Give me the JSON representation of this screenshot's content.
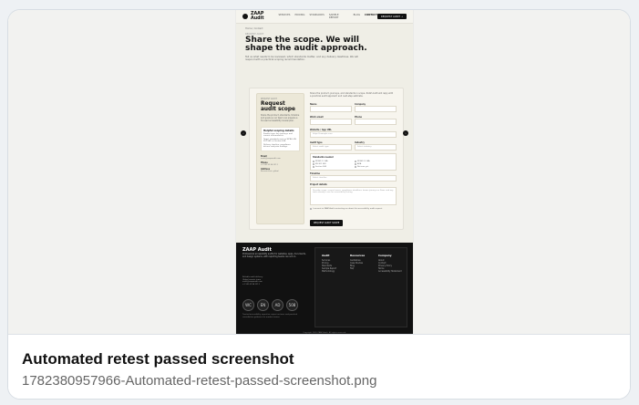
{
  "browser_capture": {
    "nav": {
      "brand": "ZAAP Audit",
      "menu": [
        "SERVICES",
        "PRICING",
        "STANDARDS",
        "SAMPLE REPORT",
        "BLOG",
        "CONTACT"
      ],
      "cta": "REQUEST AUDIT →"
    },
    "hero": {
      "breadcrumb": "Home / Contact",
      "eyebrow": "REQUEST AUDIT",
      "title": "Share the scope. We will shape the audit approach.",
      "subtitle": "Tell us what needs to be reviewed, which standards matter, and any delivery deadlines. We will respond with a practical scoping recommendation."
    },
    "form_section": {
      "left": {
        "mini": "REQUEST AUDIT",
        "title": "Request audit scope",
        "copy": "Share the product, standards, timeline and goals so our team can prepare a focused accessibility review plan.",
        "box_title": "Helpful scoping details",
        "box_items": [
          "Product type, key journeys, and current environments.",
          "Target standards such as WCAG, EN 301 549, or Section 508.",
          "Delivery timeline, compliance drivers, and prior findings."
        ],
        "contact": [
          {
            "label": "Email",
            "value": "audit@zaapaudit.com"
          },
          {
            "label": "Phone",
            "value": "+1 555 0134 2211"
          },
          {
            "label": "Address",
            "value": "Remote-first, global"
          }
        ]
      },
      "right": {
        "intro": "Share the product, journeys, and standards in scope. ZAAP Audit will reply with a practical audit approach and next-step estimate.",
        "fields": [
          {
            "label": "Name",
            "placeholder": ""
          },
          {
            "label": "Company",
            "placeholder": ""
          },
          {
            "label": "Work email",
            "placeholder": ""
          },
          {
            "label": "Phone",
            "placeholder": ""
          }
        ],
        "website": {
          "label": "Website / App URL",
          "placeholder": "https://example.com"
        },
        "selects": [
          {
            "label": "Audit type",
            "value": "Select audit type"
          },
          {
            "label": "Industry",
            "value": "Select industry"
          }
        ],
        "standards": {
          "title": "Standards needed",
          "options": [
            "WCAG 2.1 AA",
            "WCAG 2.2 AA",
            "EN 301 549",
            "ADA",
            "Section 508",
            "Not sure yet"
          ]
        },
        "timeline": {
          "label": "Timeline",
          "value": "Select timeline"
        },
        "project": {
          "label": "Project details",
          "placeholder": "Describe scope, current issues, compliance deadlines, known journeys or flows, and any tools already in use for accessibility testing."
        },
        "consent": "I consent to ZAAP Audit contacting me about this accessibility audit request.",
        "submit": "REQUEST AUDIT SCOPE"
      }
    },
    "footer": {
      "brand": "ZAAP Audit",
      "copy": "Professional accessibility audits for websites, apps, documents, and design systems, with reporting teams can act on.",
      "meta": [
        "Reliable audit delivery",
        "Global remote team",
        "audit@zaapaudit.com",
        "+1 555 0134 2211"
      ],
      "badges": [
        "WC",
        "EN",
        "AD",
        "508"
      ],
      "note": "Trusted accessibility expertise, report reviews, and practical remediation guidance for modern teams.",
      "columns": [
        {
          "title": "Audit",
          "links": [
            "Services",
            "Pricing",
            "Standards",
            "Sample Report",
            "Methodology"
          ]
        },
        {
          "title": "Resources",
          "links": [
            "Guidelines",
            "Case Studies",
            "Blog",
            "FAQ"
          ]
        },
        {
          "title": "Company",
          "links": [
            "About",
            "Contact",
            "Privacy Policy",
            "Terms",
            "Accessibility Statement"
          ]
        }
      ],
      "copyright": "Copyright 2026 ZAAP Audit. All rights reserved."
    }
  },
  "caption": {
    "title": "Automated retest passed screenshot",
    "filename": "1782380957966-Automated-retest-passed-screenshot.png"
  },
  "colors": {
    "surface": "#efeee6",
    "accent": "#111111",
    "footer": "#111111"
  }
}
